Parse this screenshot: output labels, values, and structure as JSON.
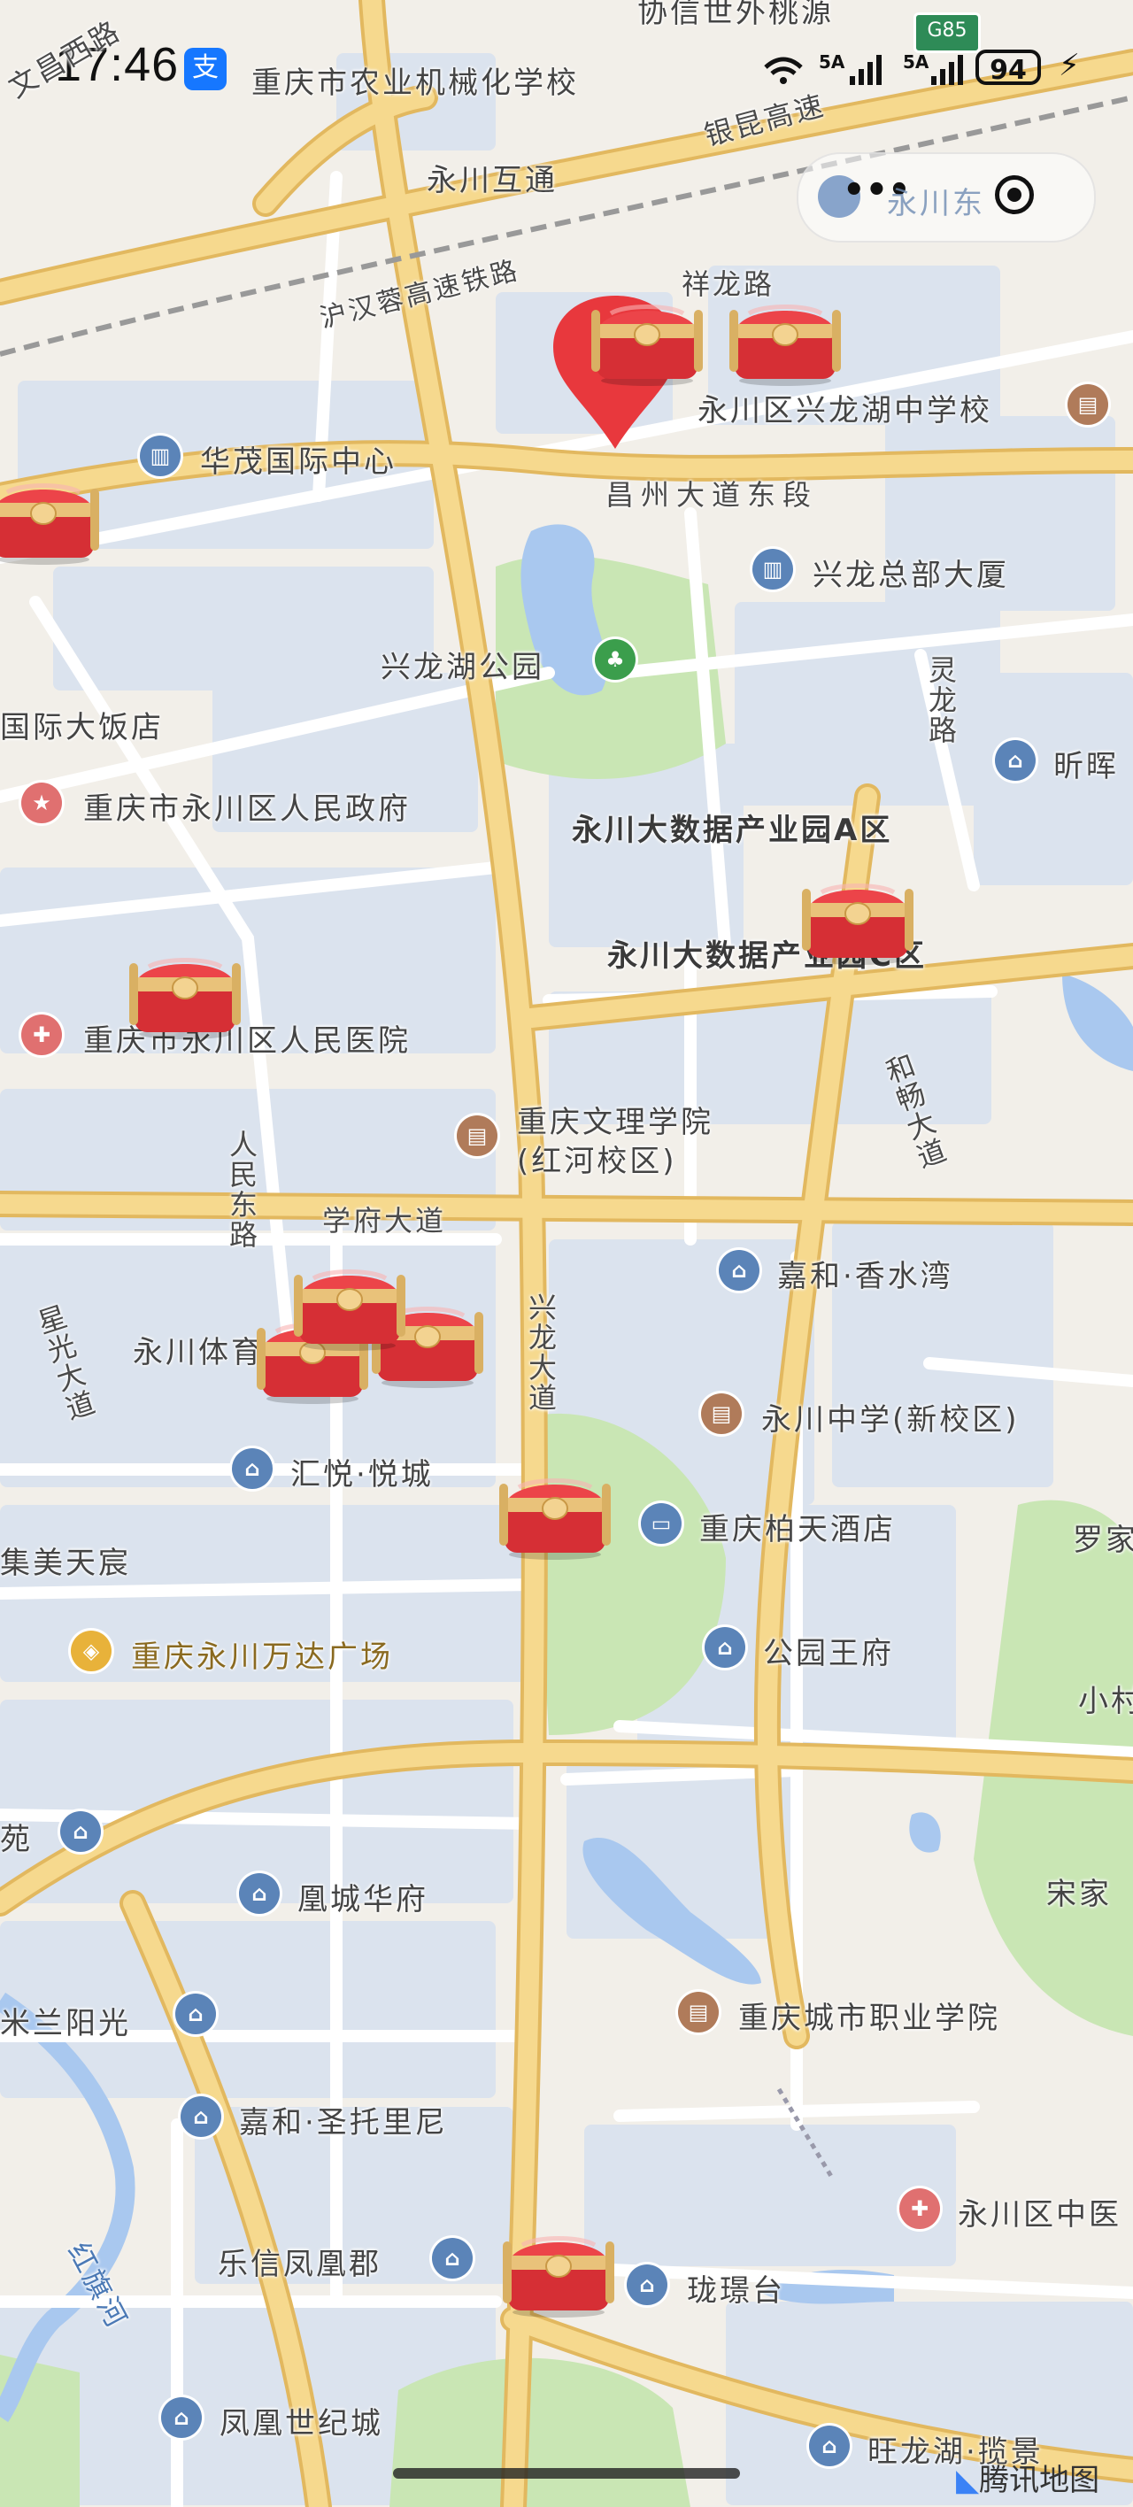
{
  "status_bar": {
    "time": "17:46",
    "alipay_glyph": "支",
    "network": "5A",
    "network2": "5A",
    "battery": "94"
  },
  "mini_program": {
    "more_label": "•••",
    "partial_location": "永川东"
  },
  "highway_shield": "G85",
  "labels": {
    "top_partial": "协信世外桃源",
    "wenchang_road": "文昌西路",
    "agri_school": "重庆市农业机械化学校",
    "yinkun_expressway": "银昆高速",
    "yongchuan_hutong": "永川互通",
    "railway": "沪汉蓉高速铁路",
    "xianglong_road": "祥龙路",
    "xinglonghu_middle": "永川区兴龙湖中学校",
    "huamao_center": "华茂国际中心",
    "changzhou_avenue": "昌州大道东段",
    "xinglong_hq": "兴龙总部大厦",
    "xinglonghu_park": "兴龙湖公园",
    "linglong_road": "灵龙路",
    "xinhui_partial": "昕晖",
    "intl_hotel": "国际大饭店",
    "gov": "重庆市永川区人民政府",
    "bigdata_a": "永川大数据产业园A区",
    "bigdata_c": "永川大数据产业园C区",
    "hospital": "重庆市永川区人民医院",
    "hechang_avenue": "和畅大道",
    "renmin_east": "人民东路",
    "wenli_college_1": "重庆文理学院",
    "wenli_college_2": "(红河校区)",
    "xuefu_avenue": "学府大道",
    "jiahe_xiangshuiwan": "嘉和·香水湾",
    "xingguang_avenue": "星光大道",
    "xinglong_avenue": "兴龙大道",
    "yongchuan_sports": "永川体育",
    "yongchuan_middle": "永川中学(新校区)",
    "huiyue_city": "汇悦·悦城",
    "bairtian_hotel": "重庆柏天酒店",
    "luojia_partial": "罗家",
    "jimei_tianchen": "集美天宸",
    "wanda_plaza": "重庆永川万达广场",
    "park_wangfu": "公园王府",
    "xiaocun_partial": "小村",
    "yuan_partial": "苑",
    "huangcheng_huafu": "凰城华府",
    "songjia_partial": "宋家",
    "milan_sunshine": "米兰阳光",
    "vocational_college": "重庆城市职业学院",
    "jiahe_santorini": "嘉和·圣托里尼",
    "hospital2_partial": "永川区中医",
    "lexin_fenghuang": "乐信凤凰郡",
    "longjingtai": "珑璟台",
    "hongqi_river": "红旗河",
    "fenghuang_century": "凤凰世纪城",
    "wanglonghu": "旺龙湖·揽景",
    "map_logo": "腾讯地图"
  },
  "icons": {
    "building": "building-icon",
    "school": "school-icon",
    "gov": "government-star-icon",
    "hospital": "hospital-icon",
    "park": "tree-icon",
    "house": "residence-icon",
    "hotel": "hotel-bed-icon",
    "mall": "shopping-bag-icon",
    "pin": "location-pin-icon",
    "chest": "treasure-chest-icon"
  },
  "colors": {
    "land": "#f2efe9",
    "block": "#dbe3ee",
    "water": "#a9c8ef",
    "green": "#c9e6b4",
    "road_major": "#f6d98e",
    "road_edge": "#e2b85f",
    "pin": "#e8383d",
    "chest_red": "#e23a3f",
    "chest_gold": "#d9b063"
  }
}
